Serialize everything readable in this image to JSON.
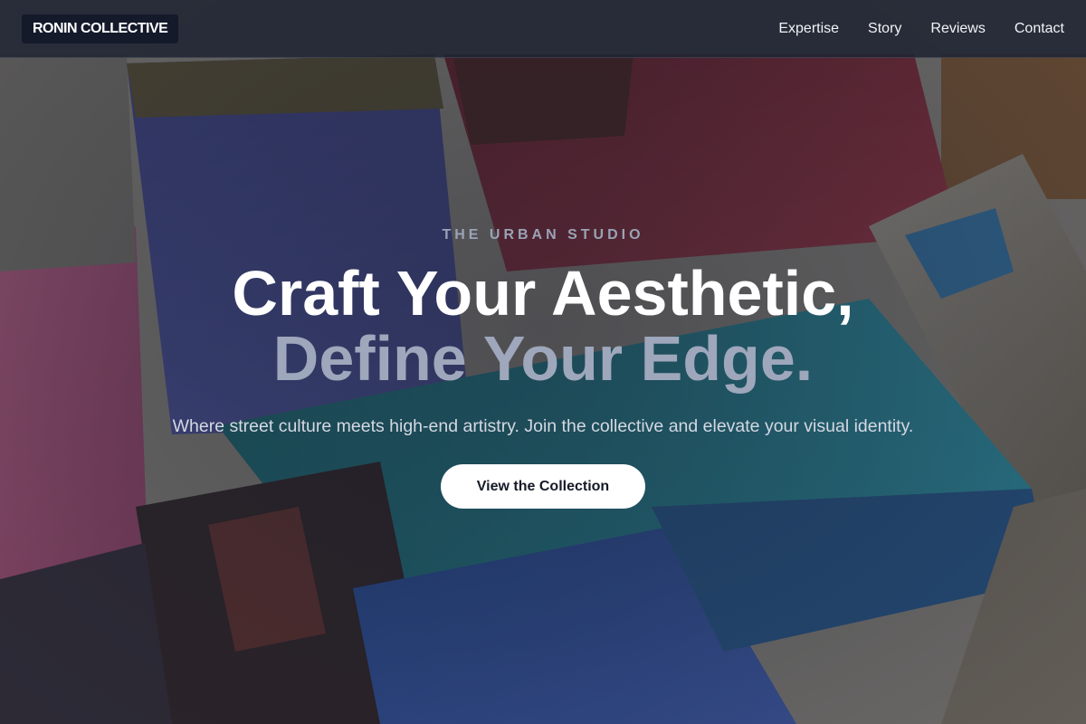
{
  "header": {
    "brand": "RONIN COLLECTIVE",
    "nav": [
      {
        "label": "Expertise"
      },
      {
        "label": "Story"
      },
      {
        "label": "Reviews"
      },
      {
        "label": "Contact"
      }
    ]
  },
  "hero": {
    "eyebrow": "THE URBAN STUDIO",
    "headline_line1": "Craft Your Aesthetic,",
    "headline_line2": "Define Your Edge.",
    "subtitle": "Where street culture meets high-end artistry. Join the collective and elevate your visual identity.",
    "cta_label": "View the Collection"
  },
  "colors": {
    "header_bg": "#1e2432",
    "brand_bg": "#141a2a",
    "headline_accent": "#9ea7bb",
    "cta_bg": "#ffffff",
    "cta_text": "#151a27"
  }
}
